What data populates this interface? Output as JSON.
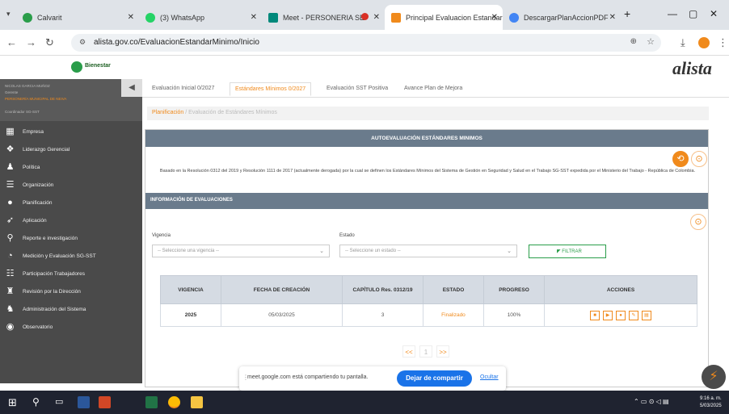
{
  "browser": {
    "tabs": [
      {
        "label": "Calvarit",
        "icon": "calendar-icon",
        "color": "#2a9d4a"
      },
      {
        "label": "(3) WhatsApp",
        "icon": "whatsapp-icon",
        "color": "#25d366"
      },
      {
        "label": "Meet - PERSONERIA SE",
        "icon": "meet-icon",
        "color": "#00897b"
      },
      {
        "label": "Principal Evaluacion Estandar",
        "icon": "alista-icon",
        "color": "#f08a1c"
      },
      {
        "label": "DescargarPlanAccionPDF",
        "icon": "chrome-icon",
        "color": "#4285f4"
      }
    ],
    "url": "alista.gov.co/EvaluacionEstandarMinimo/Inicio"
  },
  "app": {
    "logo_text": "alista",
    "left_logo": "Bienestar"
  },
  "sidebar": {
    "user_lines": [
      "NICOLAS GARCIA MUÑOZ",
      "Gerente",
      "PERSONERÍA MUNICIPAL DE NEIVA",
      "Coordinador SG-SST"
    ],
    "items": [
      {
        "label": "Empresa",
        "icon": "building-icon"
      },
      {
        "label": "Liderazgo Gerencial",
        "icon": "leadership-icon"
      },
      {
        "label": "Política",
        "icon": "person-icon"
      },
      {
        "label": "Organización",
        "icon": "list-icon"
      },
      {
        "label": "Planificación",
        "icon": "lightbulb-icon"
      },
      {
        "label": "Aplicación",
        "icon": "rocket-icon"
      },
      {
        "label": "Reporte e investigación",
        "icon": "search-icon"
      },
      {
        "label": "Medición y Evaluación SG-SST",
        "icon": "chart-icon"
      },
      {
        "label": "Participación Trabajadores",
        "icon": "group-icon"
      },
      {
        "label": "Revisión por la Dirección",
        "icon": "manager-icon"
      },
      {
        "label": "Administración del Sistema",
        "icon": "admin-icon"
      },
      {
        "label": "Observatorio",
        "icon": "globe-icon"
      }
    ]
  },
  "main": {
    "tabs": [
      "Evaluación Inicial 0/2027",
      "Estándares Mínimos 0/2027",
      "Evaluación SST Positiva",
      "Avance Plan de Mejora"
    ],
    "breadcrumb": [
      "Planificación",
      "/ Evaluación de Estándares Mínimos"
    ],
    "card_title": "AUTOEVALUACIÓN ESTÁNDARES MINIMOS",
    "description": "Basado en la Resolución 0312 del 2019 y Resolución 1111 de 2017 (actualmente derogada) por la cual se definen los Estándares Mínimos del Sistema de Gestión en Seguridad y Salud en el Trabajo SG-SST expedida por el Ministerio del Trabajo - República de Colombia.",
    "section_title": "INFORMACIÓN DE EVALUACIONES",
    "filters": {
      "vigencia_label": "Vigencia",
      "vigencia_value": "-- Seleccione una vigencia --",
      "estado_label": "Estado",
      "estado_value": "-- Seleccione un estado --",
      "filter_button": "FILTRAR"
    },
    "table": {
      "headers": [
        "VIGENCIA",
        "FECHA DE CREACIÓN",
        "CAPÍTULO Res. 0312/19",
        "ESTADO",
        "PROGRESO",
        "ACCIONES"
      ],
      "rows": [
        {
          "vigencia": "2025",
          "fecha": "05/03/2025",
          "capitulo": "3",
          "estado": "Finalizado",
          "progreso": "100%"
        }
      ]
    },
    "pager": [
      "<<",
      "1",
      ">>"
    ]
  },
  "share_bar": {
    "text": "meet.google.com está compartiendo tu pantalla.",
    "stop_button": "Dejar de compartir",
    "hide_link": "Ocultar"
  },
  "taskbar": {
    "time": "9:16 a. m.",
    "date": "5/03/2025"
  },
  "colors": {
    "accent": "#f08a1c",
    "header": "#6a7b8c",
    "sidebar": "#4a4a4a",
    "meet_blue": "#1a73e8"
  }
}
